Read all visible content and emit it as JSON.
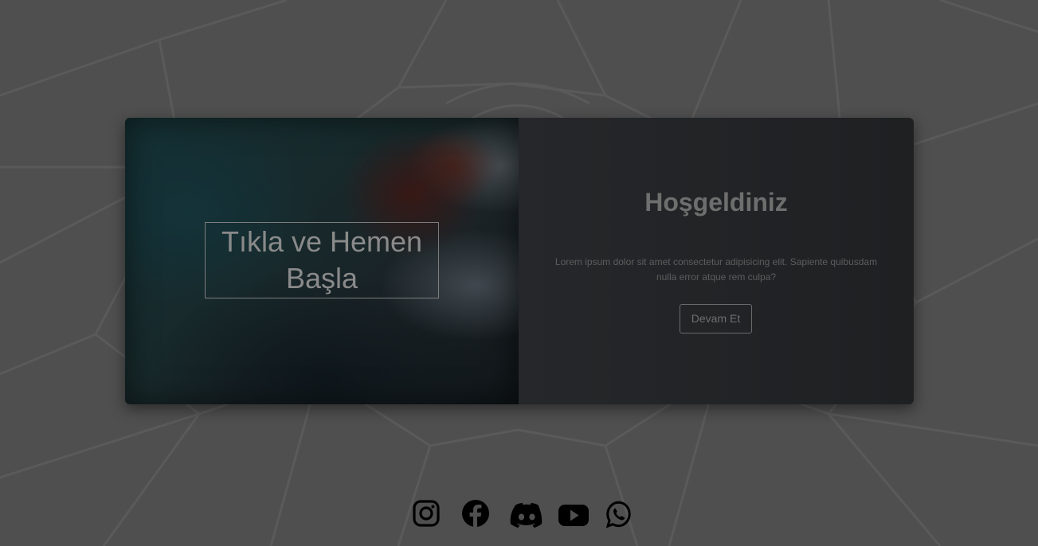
{
  "hero": {
    "cta_line1": "Tıkla ve Hemen",
    "cta_line2": "Başla"
  },
  "welcome": {
    "title": "Hoşgeldiniz",
    "text_line1": "Lorem ipsum dolor sit amet consectetur adipisicing elit. Sapiente quibusdam",
    "text_line2": "nulla error atque rem culpa?",
    "button_label": "Devam Et"
  },
  "social": {
    "icons": [
      "instagram-icon",
      "facebook-icon",
      "discord-icon",
      "youtube-icon",
      "whatsapp-icon"
    ]
  },
  "colors": {
    "page_background": "#4f4f4f",
    "panel_background": "#222427",
    "icon_color": "#000000"
  }
}
